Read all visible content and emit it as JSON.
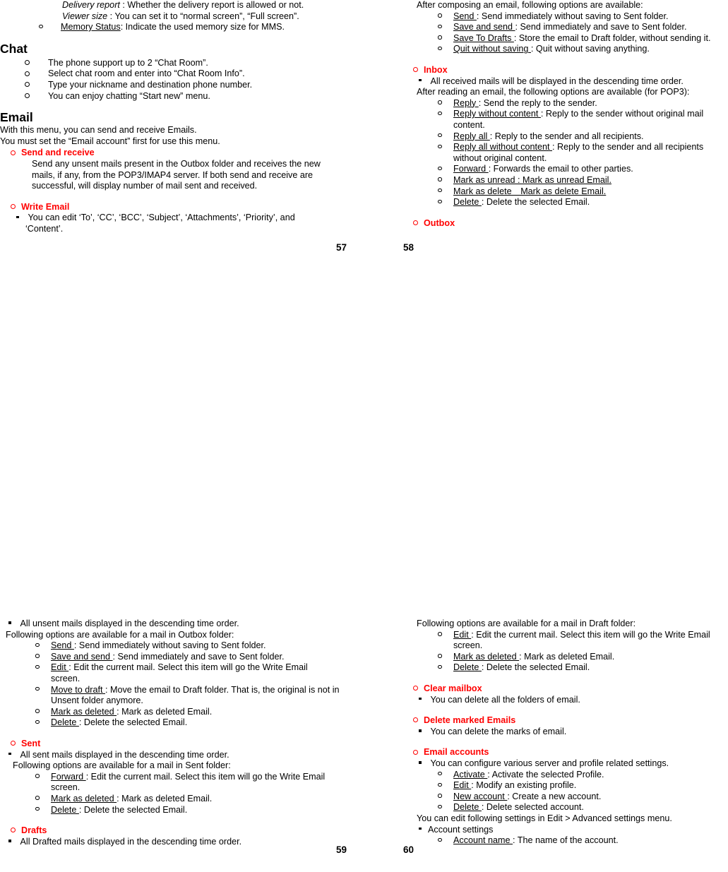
{
  "pages": {
    "p57": {
      "number": "57",
      "intro": [
        {
          "italic_term": "Delivery report",
          "rest": " : Whether the delivery report is allowed or not."
        },
        {
          "italic_term": "Viewer size",
          "rest": " : You can set it to “normal screen”, “Full screen”."
        }
      ],
      "memory_status": {
        "term": "Memory Status",
        "rest": ": Indicate the used memory size for MMS."
      },
      "chat": {
        "heading": "Chat",
        "items": [
          "The phone support up to 2 “Chat Room”.",
          "Select chat room and enter into “Chat Room Info”.",
          "Type your nickname and destination phone number.",
          "You can enjoy chatting “Start new” menu."
        ]
      },
      "email": {
        "heading": "Email",
        "line1": "With this menu, you can send and receive Emails.",
        "line2": "You must set the “Email account” first for use this menu.",
        "send_and_receive": {
          "label": "Send and receive",
          "body": "Send any unsent mails present in the Outbox folder and receives the new mails, if any, from the POP3/IMAP4 server. If both send and receive are successful, will display number of mail sent and received."
        },
        "write_email": {
          "label": "Write Email",
          "body": " You can edit ‘To’, ‘CC’, ‘BCC’, ‘Subject’, ‘Attachments’, ‘Priority’, and ‘Content’."
        }
      }
    },
    "p58": {
      "number": "58",
      "compose_intro": "After composing an email, following options are available:",
      "compose_options": [
        {
          "term": "Send ",
          "rest": ": Send immediately without saving to Sent folder."
        },
        {
          "term": "Save and send ",
          "rest": ": Send immediately and save to Sent folder."
        },
        {
          "term": "Save To Drafts ",
          "rest": ": Store the email to Draft folder, without sending it."
        },
        {
          "term": "Quit without saving ",
          "rest": ": Quit without saving anything."
        }
      ],
      "inbox": {
        "label": "Inbox",
        "note": " All received mails will be displayed in the descending time order.",
        "after_read": "After reading an email, the following options are available (for POP3):",
        "options": [
          {
            "term": "Reply ",
            "rest": ": Send the reply to the sender."
          },
          {
            "term": "Reply without content ",
            "rest": ": Reply to the sender without original mail content."
          },
          {
            "term": "Reply all ",
            "rest": ": Reply to the sender and all recipients."
          },
          {
            "term": "Reply all without content ",
            "rest": ": Reply to the sender and all recipients without original content."
          },
          {
            "term": "Forward ",
            "rest": ": Forwards the email to other parties."
          },
          {
            "term_full": "Mark as unread : Mark as unread Email."
          },
          {
            "term_full": "Mark as delete Mark as delete Email."
          },
          {
            "term": "Delete ",
            "rest": ": Delete the selected Email."
          }
        ]
      },
      "outbox": {
        "label": "Outbox"
      }
    },
    "p59": {
      "number": "59",
      "outbox_note": " All unsent mails displayed in the descending time order.",
      "outbox_intro": "Following options are available for a mail in Outbox folder:",
      "outbox_options": [
        {
          "term": "Send ",
          "rest": ": Send immediately without saving to Sent folder."
        },
        {
          "term": "Save and send ",
          "rest": ": Send immediately and save to Sent folder."
        },
        {
          "term": "Edit ",
          "rest": ": Edit the current mail. Select this item will go the Write Email screen."
        },
        {
          "term": "Move to draft ",
          "rest": ": Move the email to Draft folder. That is, the original is not in Unsent folder anymore."
        },
        {
          "term": "Mark as deleted ",
          "rest": ": Mark as deleted Email."
        },
        {
          "term": "Delete ",
          "rest": ": Delete the selected Email."
        }
      ],
      "sent": {
        "label": "Sent",
        "note": " All sent mails displayed in the descending time order.",
        "intro": "Following options are available for a mail in Sent folder:",
        "options": [
          {
            "term": "Forward ",
            "rest": ": Edit the current mail. Select this item will go the Write Email screen."
          },
          {
            "term": "Mark as deleted ",
            "rest": ": Mark as deleted Email."
          },
          {
            "term": "Delete ",
            "rest": ": Delete the selected Email."
          }
        ]
      },
      "drafts": {
        "label": "Drafts",
        "note": " All Drafted mails displayed in the descending time order."
      }
    },
    "p60": {
      "number": "60",
      "draft_intro": "Following options are available for a mail in Draft folder:",
      "draft_options": [
        {
          "term": "Edit ",
          "rest": ": Edit the current mail. Select this item will go the Write Email screen."
        },
        {
          "term": "Mark as deleted ",
          "rest": ": Mark as deleted Email."
        },
        {
          "term": "Delete ",
          "rest": ": Delete the selected Email."
        }
      ],
      "clear_mailbox": {
        "label": "Clear mailbox",
        "note": " You can delete all the folders of email."
      },
      "delete_marked": {
        "label": "Delete marked Emails",
        "note": " You can delete the marks of email."
      },
      "email_accounts": {
        "label": "Email accounts",
        "note": " You can configure various server and profile related settings.",
        "options": [
          {
            "term": "Activate ",
            "rest": ": Activate the selected Profile."
          },
          {
            "term": "Edit ",
            "rest": ": Modify an existing profile."
          },
          {
            "term": "New account ",
            "rest": ": Create a new account."
          },
          {
            "term": "Delete ",
            "rest": ": Delete selected account."
          }
        ],
        "advanced_line": "You can edit following settings in Edit > Advanced settings menu.",
        "account_settings_label": "Account settings",
        "account_settings_options": [
          {
            "term": "Account name ",
            "rest": ": The name of the account."
          }
        ]
      }
    }
  },
  "colors": {
    "accent": "#FF0000",
    "text": "#000000",
    "background": "#FFFFFF"
  }
}
